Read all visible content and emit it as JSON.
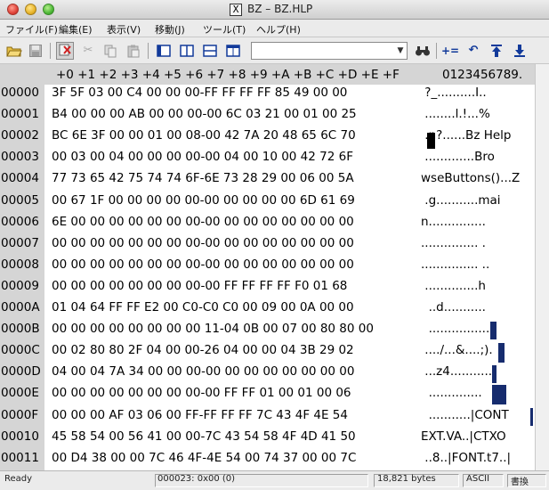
{
  "window": {
    "title": "BZ – BZ.HLP",
    "app_icon": "X"
  },
  "menu": [
    "ファイル(F)",
    "編集(E)",
    "表示(V)",
    "移動(J)",
    "ツール(T)",
    "ヘルプ(H)"
  ],
  "toolbar": {
    "icons": [
      "open-folder-icon",
      "save-icon",
      "delete-icon",
      "cut-icon",
      "copy-icon",
      "paste-icon",
      "single-view-icon",
      "split-vertical-icon",
      "split-horizontal-icon",
      "compare-view-icon",
      "find-icon",
      "add-bookmark-icon",
      "undo-icon",
      "jump-up-icon",
      "jump-down-icon"
    ],
    "search_value": ""
  },
  "hex_view": {
    "header": "+0 +1 +2 +3 +4 +5 +6 +7 +8 +9 +A +B +C +D +E +F",
    "text_header": "0123456789.",
    "rows": [
      {
        "addr": "00000",
        "hex": "3F 5F 03 00 C4 00 00 00-FF FF FF FF 85 49 00 00",
        "text": " ?_..........I.."
      },
      {
        "addr": "00001",
        "hex": "B4 00 00 00 AB 00 00 00-00 6C 03 21 00 01 00 25",
        "text": " ........l.!...%"
      },
      {
        "addr": "00002",
        "hex": "BC 6E 3F 00 00 01 00 08-00 42 7A 20 48 65 6C 70",
        "text": " .n?......Bz Help"
      },
      {
        "addr": "00003",
        "hex": "00 03 00 04 00 00 00 00-00 04 00 10 00 42 72 6F",
        "text": " .............Bro"
      },
      {
        "addr": "00004",
        "hex": "77 73 65 42 75 74 74 6F-6E 73 28 29 00 06 00 5A",
        "text": "wseButtons()...Z"
      },
      {
        "addr": "00005",
        "hex": "00 67 1F 00 00 00 00 00-00 00 00 00 00 6D 61 69",
        "text": " .g...........mai"
      },
      {
        "addr": "00006",
        "hex": "6E 00 00 00 00 00 00 00-00 00 00 00 00 00 00 00",
        "text": "n..............."
      },
      {
        "addr": "00007",
        "hex": "00 00 00 00 00 00 00 00-00 00 00 00 00 00 00 00",
        "text": "............... ."
      },
      {
        "addr": "00008",
        "hex": "00 00 00 00 00 00 00 00-00 00 00 00 00 00 00 00",
        "text": "............... .."
      },
      {
        "addr": "00009",
        "hex": "00 00 00 00 00 00 00 00-00 FF FF FF FF F0 01 68",
        "text": " ..............h"
      },
      {
        "addr": "0000A",
        "hex": "01 04 64 FF FF E2 00 C0-C0 C0 00 09 00 0A 00 00",
        "text": "  ..d..........."
      },
      {
        "addr": "0000B",
        "hex": "00 00 00 00 00 00 00 00 11-04 0B 00 07 00 80 80 00",
        "text": "  ................"
      },
      {
        "addr": "0000C",
        "hex": "00 02 80 80 2F 04 00 00-26 04 00 00 04 3B 29 02",
        "text": " ..../...&....;)."
      },
      {
        "addr": "0000D",
        "hex": "04 00 04 7A 34 00 00 00-00 00 00 00 00 00 00 00",
        "text": " ...z4..........."
      },
      {
        "addr": "0000E",
        "hex": "00 00 00 00 00 00 00 00-00 FF FF 01 00 01 00 06",
        "text": "  .............."
      },
      {
        "addr": "0000F",
        "hex": "00 00 00 AF 03 06 00 FF-FF FF FF 7C 43 4F 4E 54",
        "text": "  ...........|CONT"
      },
      {
        "addr": "00010",
        "hex": "45 58 54 00 56 41 00 00-7C 43 54 58 4F 4D 41 50",
        "text": "EXT.VA..|CTXO"
      },
      {
        "addr": "00011",
        "hex": "00 D4 38 00 00 7C 46 4F-4E 54 00 74 37 00 00 7C",
        "text": " ..8..|FONT.t7..|"
      }
    ]
  },
  "status": {
    "ready": "Ready",
    "offset": "000023: 0x00 (0)",
    "size": "18,821 bytes",
    "encoding": "ASCII",
    "mode": "書換"
  }
}
